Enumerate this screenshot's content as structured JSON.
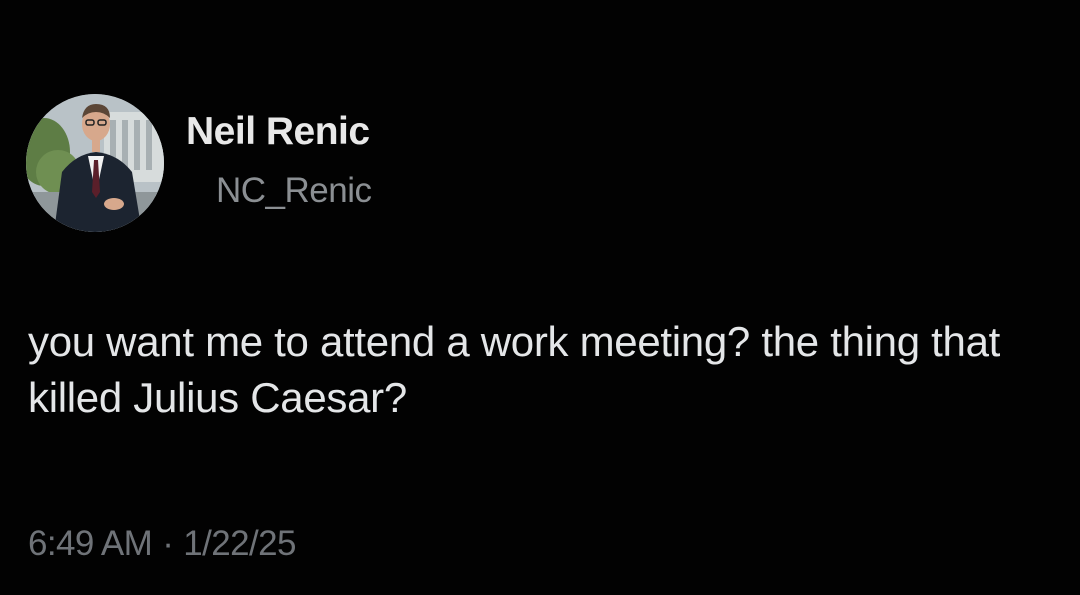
{
  "author": {
    "display_name": "Neil Renic",
    "handle": "NC_Renic",
    "avatar_icon": "profile-photo-icon"
  },
  "post": {
    "text": "you want me to attend a work meeting? the thing that killed Julius Caesar?",
    "time": "6:49 AM",
    "separator": "·",
    "date": "1/22/25"
  },
  "colors": {
    "background": "#020202",
    "primary_text": "#e4e6e8",
    "secondary_text": "#8b8f93",
    "muted_text": "#6f7378"
  }
}
